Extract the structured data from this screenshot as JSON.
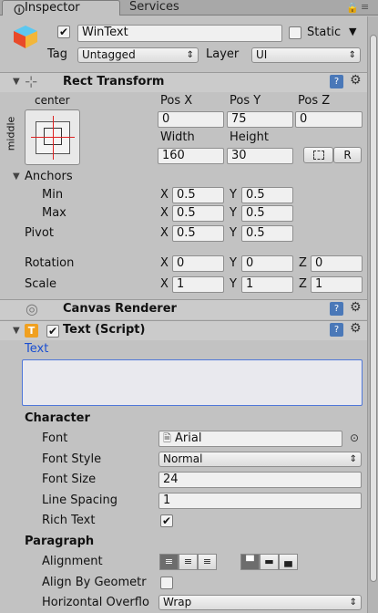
{
  "tabs": [
    {
      "label": "Inspector",
      "icon": "info-icon"
    },
    {
      "label": "Services"
    }
  ],
  "object": {
    "name": "WinText",
    "active": true,
    "static_label": "Static",
    "tag_label": "Tag",
    "tag_value": "Untagged",
    "layer_label": "Layer",
    "layer_value": "UI"
  },
  "rect_transform": {
    "title": "Rect Transform",
    "anchor_preset_h": "center",
    "anchor_preset_v": "middle",
    "pos_x_label": "Pos X",
    "pos_y_label": "Pos Y",
    "pos_z_label": "Pos Z",
    "pos_x": "0",
    "pos_y": "75",
    "pos_z": "0",
    "width_label": "Width",
    "height_label": "Height",
    "width": "160",
    "height": "30",
    "r_button": "R",
    "anchors_label": "Anchors",
    "min_label": "Min",
    "max_label": "Max",
    "min_x": "0.5",
    "min_y": "0.5",
    "max_x": "0.5",
    "max_y": "0.5",
    "pivot_label": "Pivot",
    "pivot_x": "0.5",
    "pivot_y": "0.5",
    "rotation_label": "Rotation",
    "rot_x": "0",
    "rot_y": "0",
    "rot_z": "0",
    "scale_label": "Scale",
    "scale_x": "1",
    "scale_y": "1",
    "scale_z": "1",
    "x": "X",
    "y": "Y",
    "z": "Z"
  },
  "canvas_renderer": {
    "title": "Canvas Renderer"
  },
  "text_script": {
    "title": "Text (Script)",
    "text_label": "Text",
    "text_value": "",
    "character_label": "Character",
    "font_label": "Font",
    "font_value": "Arial",
    "font_style_label": "Font Style",
    "font_style_value": "Normal",
    "font_size_label": "Font Size",
    "font_size_value": "24",
    "line_spacing_label": "Line Spacing",
    "line_spacing_value": "1",
    "rich_text_label": "Rich Text",
    "rich_text": true,
    "paragraph_label": "Paragraph",
    "alignment_label": "Alignment",
    "align_by_geometry_label": "Align By Geometr",
    "horizontal_overflow_label": "Horizontal Overflo",
    "horizontal_overflow_value": "Wrap"
  },
  "colors": {
    "link_blue": "#1a4fd0",
    "header_bg": "#cbcbcb",
    "panel_bg": "#c2c2c2"
  }
}
